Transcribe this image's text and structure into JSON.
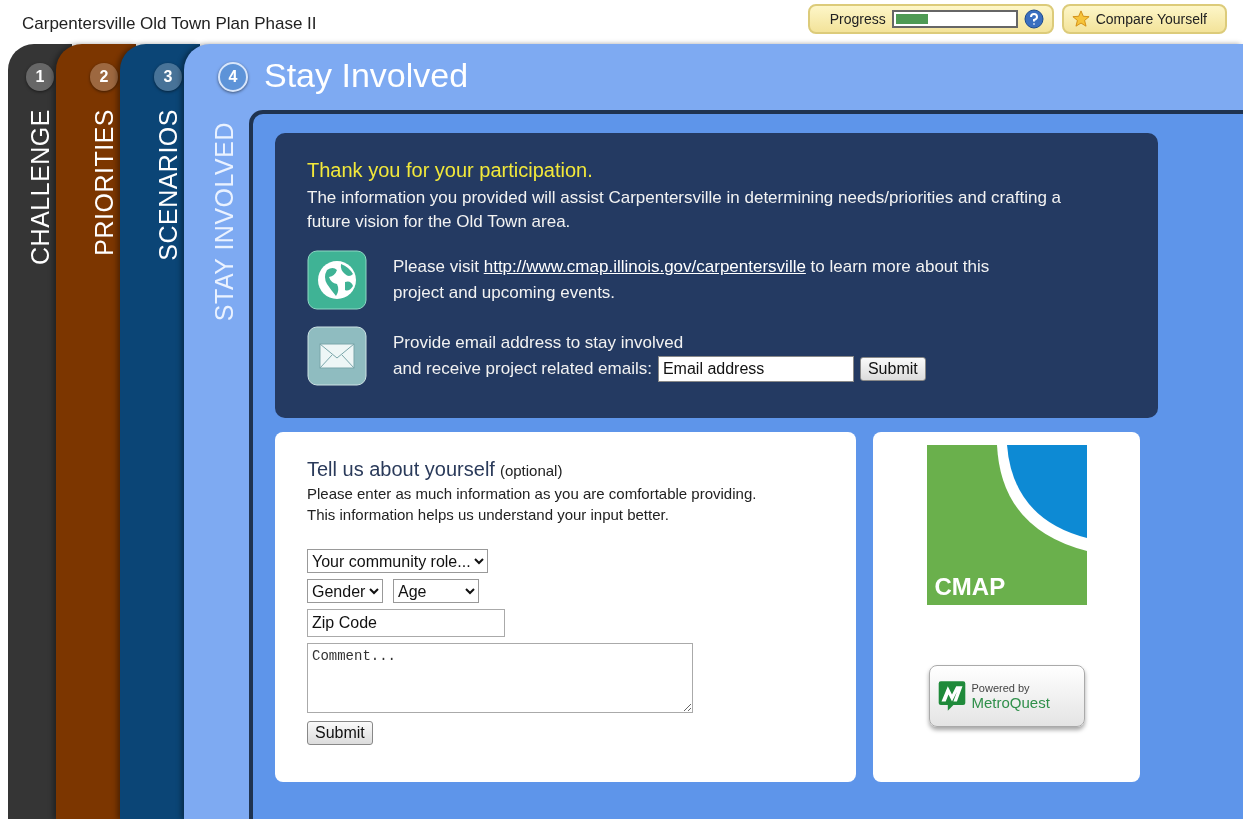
{
  "header": {
    "title": "Carpentersville Old Town Plan Phase II",
    "progress_label": "Progress",
    "level": 0.27,
    "compare_button": "Compare Yourself"
  },
  "tabs": [
    {
      "number": "1",
      "label": "CHALLENGE",
      "color": "#353535",
      "selected": false
    },
    {
      "number": "2",
      "label": "PRIORITIES",
      "color": "#7c3600",
      "selected": false
    },
    {
      "number": "3",
      "label": "SCENARIOS",
      "color": "#0b4576",
      "selected": false
    },
    {
      "number": "4",
      "label": "STAY INVOLVED",
      "color": "#7eaaf2",
      "selected": true
    }
  ],
  "page_title": "Stay Involved",
  "thanks": {
    "heading": "Thank you for your participation.",
    "text": "The information you provided will assist Carpentersville in determining needs/priorities and crafting a future vision for the Old Town area.",
    "visit_before": "Please visit",
    "link": "http://www.cmap.illinois.gov/carpentersville",
    "visit_after": "to learn more about this project and upcoming events.",
    "email_line_1": "Provide email address to stay involved",
    "email_line_2": "and receive project related emails:",
    "email_placeholder": "Email address",
    "submit": "Submit"
  },
  "about": {
    "heading": "Tell us about yourself",
    "heading_note": "(optional)",
    "text": "Please enter as much information as you are comfortable providing. This information helps us understand your input better.",
    "community_select": "Your community role...",
    "gender_select": "Gender",
    "age_select": "Age",
    "zip_placeholder": "Zip Code",
    "comment_placeholder": "Comment...",
    "submit": "Submit"
  },
  "logos": {
    "cmap": "CMAP",
    "powered_by": "Powered by",
    "metroquest": "MetroQuest"
  }
}
